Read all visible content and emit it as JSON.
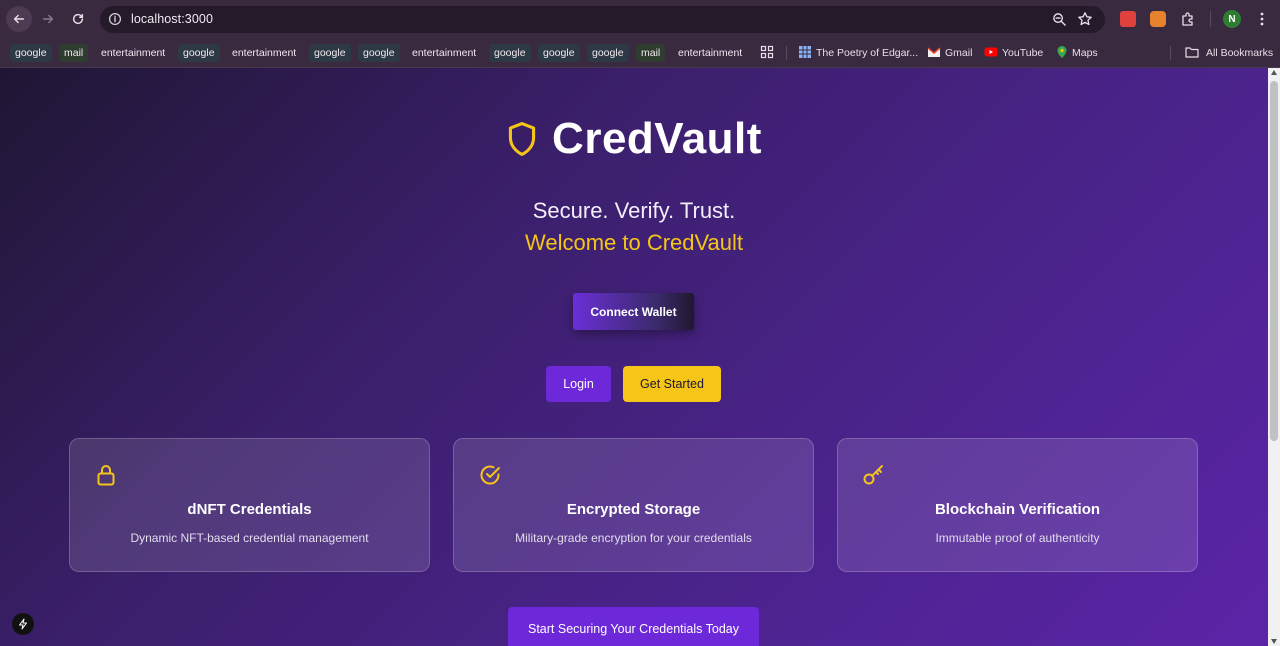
{
  "browser": {
    "url": "localhost:3000",
    "profile_initial": "N",
    "bookmarks": [
      {
        "label": "google",
        "kind": "tag"
      },
      {
        "label": "mail",
        "kind": "mail"
      },
      {
        "label": "entertainment",
        "kind": "plain"
      },
      {
        "label": "google",
        "kind": "tag"
      },
      {
        "label": "entertainment",
        "kind": "plain"
      },
      {
        "label": "google",
        "kind": "tag"
      },
      {
        "label": "google",
        "kind": "tag"
      },
      {
        "label": "entertainment",
        "kind": "plain"
      },
      {
        "label": "google",
        "kind": "tag"
      },
      {
        "label": "google",
        "kind": "tag"
      },
      {
        "label": "google",
        "kind": "tag"
      },
      {
        "label": "mail",
        "kind": "mail"
      },
      {
        "label": "entertainment",
        "kind": "plain"
      }
    ],
    "bookmark_links": {
      "poetry": "The Poetry of Edgar...",
      "gmail": "Gmail",
      "youtube": "YouTube",
      "maps": "Maps",
      "all_bookmarks": "All Bookmarks"
    }
  },
  "hero": {
    "brand": "CredVault",
    "tagline": "Secure. Verify. Trust.",
    "welcome": "Welcome to CredVault",
    "connect_wallet": "Connect Wallet",
    "login": "Login",
    "get_started": "Get Started"
  },
  "features": [
    {
      "icon": "lock-icon",
      "title": "dNFT Credentials",
      "description": "Dynamic NFT-based credential management"
    },
    {
      "icon": "check-circle-icon",
      "title": "Encrypted Storage",
      "description": "Military-grade encryption for your credentials"
    },
    {
      "icon": "key-icon",
      "title": "Blockchain Verification",
      "description": "Immutable proof of authenticity"
    }
  ],
  "cta": {
    "label": "Start Securing Your Credentials Today"
  },
  "colors": {
    "accent": "#f5c518",
    "primary": "#6d28d9"
  }
}
